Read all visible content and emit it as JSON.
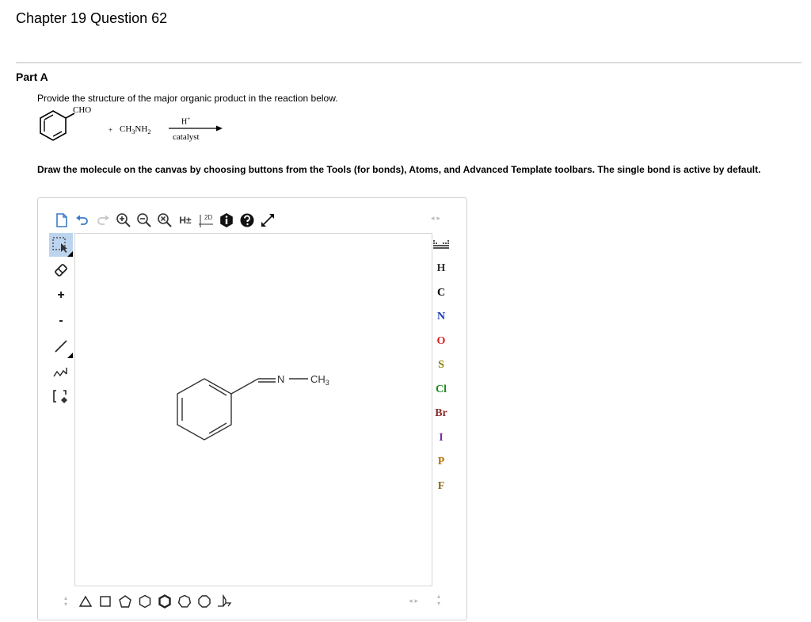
{
  "header": {
    "chapter_title": "Chapter 19 Question 62"
  },
  "part": {
    "title": "Part A",
    "question": "Provide the structure of the major organic product in the reaction below.",
    "instruction": "Draw the molecule on the canvas by choosing buttons from the Tools (for bonds), Atoms, and Advanced Template toolbars. The single bond is active by default."
  },
  "reaction": {
    "substituent": "CHO",
    "plus": "+",
    "reagent": "CH3NH2",
    "catalyst_top": "H+",
    "catalyst_bottom": "catalyst"
  },
  "toolbar": {
    "hydrogen_label": "H±",
    "view_2d_label": "2D"
  },
  "left_toolbar": {
    "plus_label": "+",
    "minus_label": "-"
  },
  "atoms": [
    {
      "symbol": "H",
      "color": "#333333"
    },
    {
      "symbol": "C",
      "color": "#000000"
    },
    {
      "symbol": "N",
      "color": "#1a3bb5"
    },
    {
      "symbol": "O",
      "color": "#e02020"
    },
    {
      "symbol": "S",
      "color": "#8a7a00"
    },
    {
      "symbol": "Cl",
      "color": "#1a8a1a"
    },
    {
      "symbol": "Br",
      "color": "#8a2a2a"
    },
    {
      "symbol": "I",
      "color": "#7a2aa0"
    },
    {
      "symbol": "P",
      "color": "#c07000"
    },
    {
      "symbol": "F",
      "color": "#8a6a1a"
    }
  ],
  "canvas_molecule": {
    "nitrogen": "N",
    "methyl": "CH3"
  }
}
